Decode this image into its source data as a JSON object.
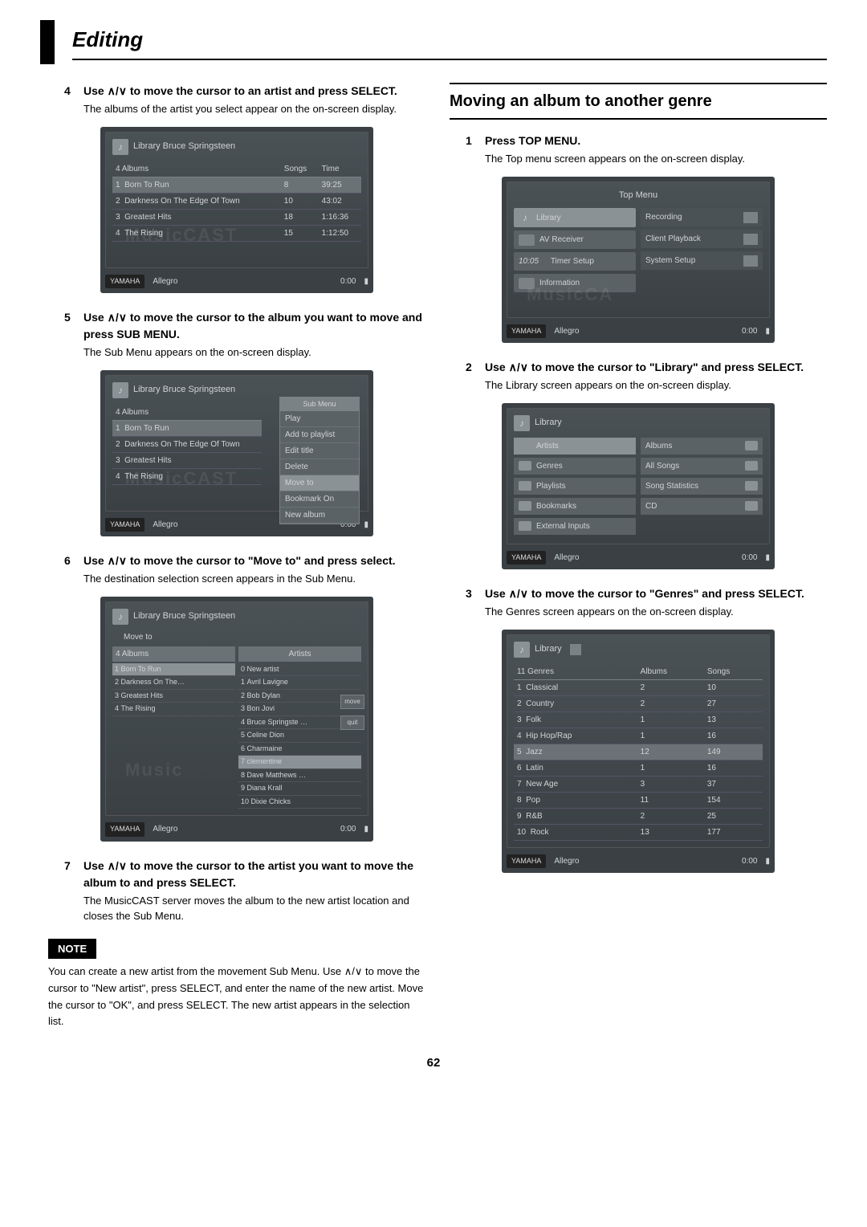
{
  "page_title": "Editing",
  "page_number": "62",
  "left": {
    "step4": {
      "num": "4",
      "title_pre": "Use ",
      "title_post": " to move the cursor to an artist and press SELECT.",
      "body": "The albums of the artist you select appear on the on-screen display."
    },
    "screen1": {
      "breadcrumb": "Library     Bruce Springsteen",
      "count_label": "4  Albums",
      "cols": {
        "c1": "Songs",
        "c2": "Time"
      },
      "rows": [
        {
          "n": "1",
          "name": "Born To Run",
          "songs": "8",
          "time": "39:25",
          "sel": true
        },
        {
          "n": "2",
          "name": "Darkness On The Edge Of Town",
          "songs": "10",
          "time": "43:02"
        },
        {
          "n": "3",
          "name": "Greatest Hits",
          "songs": "18",
          "time": "1:16:36"
        },
        {
          "n": "4",
          "name": "The Rising",
          "songs": "15",
          "time": "1:12:50"
        }
      ],
      "watermark": "MusicCAST",
      "brand": "YAMAHA",
      "mode": "Allegro",
      "time": "0:00"
    },
    "step5": {
      "num": "5",
      "title_pre": "Use ",
      "title_post": " to move the cursor to the album you want to move and press SUB MENU.",
      "body": "The Sub Menu appears on the on-screen display."
    },
    "screen2": {
      "breadcrumb": "Library     Bruce Springsteen",
      "count_label": "4  Albums",
      "rows": [
        {
          "n": "1",
          "name": "Born To Run",
          "sel": true
        },
        {
          "n": "2",
          "name": "Darkness On The Edge Of Town"
        },
        {
          "n": "3",
          "name": "Greatest Hits"
        },
        {
          "n": "4",
          "name": "The Rising"
        }
      ],
      "submenu_title": "Sub Menu",
      "submenu": [
        "Play",
        "Add to playlist",
        "Edit title",
        "Delete",
        "Move to",
        "Bookmark On",
        "New album"
      ],
      "submenu_sel": 4,
      "watermark": "MusicCAST",
      "brand": "YAMAHA",
      "mode": "Allegro",
      "time": "0:00"
    },
    "step6": {
      "num": "6",
      "title_pre": "Use ",
      "title_post": " to move the cursor to \"Move to\" and press select.",
      "body": "The destination selection screen appears in the Sub Menu."
    },
    "screen3": {
      "breadcrumb": "Library     Bruce Springsteen",
      "move_to": "Move to",
      "left_title": "4  Albums",
      "left_rows": [
        {
          "n": "1",
          "name": "Born To Run",
          "sel": true
        },
        {
          "n": "2",
          "name": "Darkness On The…"
        },
        {
          "n": "3",
          "name": "Greatest Hits"
        },
        {
          "n": "4",
          "name": "The Rising"
        }
      ],
      "right_title": "Artists",
      "right_rows": [
        {
          "n": "0",
          "name": "New artist"
        },
        {
          "n": "1",
          "name": "Avril Lavigne"
        },
        {
          "n": "2",
          "name": "Bob Dylan"
        },
        {
          "n": "3",
          "name": "Bon Jovi"
        },
        {
          "n": "4",
          "name": "Bruce Springste …"
        },
        {
          "n": "5",
          "name": "Celine Dion"
        },
        {
          "n": "6",
          "name": "Charmaine"
        },
        {
          "n": "7",
          "name": "clementine",
          "sel": true
        },
        {
          "n": "8",
          "name": "Dave Matthews …"
        },
        {
          "n": "9",
          "name": "Diana Krall"
        },
        {
          "n": "10",
          "name": "Dixie Chicks"
        }
      ],
      "side_icons": [
        {
          "label": "move"
        },
        {
          "label": "quit"
        }
      ],
      "watermark": "Music",
      "brand": "YAMAHA",
      "mode": "Allegro",
      "time": "0:00"
    },
    "step7": {
      "num": "7",
      "title_pre": "Use ",
      "title_post": " to move the cursor to the artist you want to move the album to and press SELECT.",
      "body": "The MusicCAST server moves the album to the new artist location and closes the Sub Menu."
    },
    "note_label": "NOTE",
    "note_text": "You can create a new artist from the movement Sub Menu. Use ∧/∨ to move the cursor to \"New artist\", press SELECT, and enter the name of the new artist. Move the cursor to \"OK\", and press SELECT. The new artist appears in the selection list."
  },
  "right": {
    "section_title": "Moving an album to another genre",
    "step1": {
      "num": "1",
      "title": "Press TOP MENU.",
      "body": "The Top menu screen appears on the on-screen display."
    },
    "screen_top": {
      "title": "Top Menu",
      "left_items": [
        {
          "label": "Library",
          "sel": true
        },
        {
          "label": "AV Receiver"
        },
        {
          "label": "Timer Setup",
          "prefix": "10:05"
        },
        {
          "label": "Information"
        }
      ],
      "right_items": [
        {
          "label": "Recording"
        },
        {
          "label": "Client Playback"
        },
        {
          "label": "System Setup"
        }
      ],
      "watermark": "MusicCA",
      "brand": "YAMAHA",
      "mode": "Allegro",
      "time": "0:00"
    },
    "step2": {
      "num": "2",
      "title_pre": "Use ",
      "title_post": " to move the cursor to \"Library\" and press SELECT.",
      "body": "The Library screen appears on the on-screen display."
    },
    "screen_lib": {
      "title": "Library",
      "left_items": [
        {
          "label": "Artists",
          "sel": true
        },
        {
          "label": "Genres"
        },
        {
          "label": "Playlists"
        },
        {
          "label": "Bookmarks"
        },
        {
          "label": "External Inputs"
        }
      ],
      "right_items": [
        {
          "label": "Albums"
        },
        {
          "label": "All Songs"
        },
        {
          "label": "Song Statistics"
        },
        {
          "label": "CD"
        }
      ],
      "brand": "YAMAHA",
      "mode": "Allegro",
      "time": "0:00"
    },
    "step3": {
      "num": "3",
      "title_pre": "Use ",
      "title_post": " to move the cursor to \"Genres\" and press SELECT.",
      "body": "The Genres screen appears on the on-screen display."
    },
    "screen_genres": {
      "breadcrumb": "Library",
      "count_label": "11  Genres",
      "cols": {
        "c1": "Albums",
        "c2": "Songs"
      },
      "rows": [
        {
          "n": "1",
          "name": "Classical",
          "a": "2",
          "s": "10"
        },
        {
          "n": "2",
          "name": "Country",
          "a": "2",
          "s": "27"
        },
        {
          "n": "3",
          "name": "Folk",
          "a": "1",
          "s": "13"
        },
        {
          "n": "4",
          "name": "Hip Hop/Rap",
          "a": "1",
          "s": "16"
        },
        {
          "n": "5",
          "name": "Jazz",
          "a": "12",
          "s": "149",
          "sel": true
        },
        {
          "n": "6",
          "name": "Latin",
          "a": "1",
          "s": "16"
        },
        {
          "n": "7",
          "name": "New Age",
          "a": "3",
          "s": "37"
        },
        {
          "n": "8",
          "name": "Pop",
          "a": "11",
          "s": "154"
        },
        {
          "n": "9",
          "name": "R&B",
          "a": "2",
          "s": "25"
        },
        {
          "n": "10",
          "name": "Rock",
          "a": "13",
          "s": "177"
        }
      ],
      "brand": "YAMAHA",
      "mode": "Allegro",
      "time": "0:00"
    }
  },
  "arrows": "∧/∨"
}
